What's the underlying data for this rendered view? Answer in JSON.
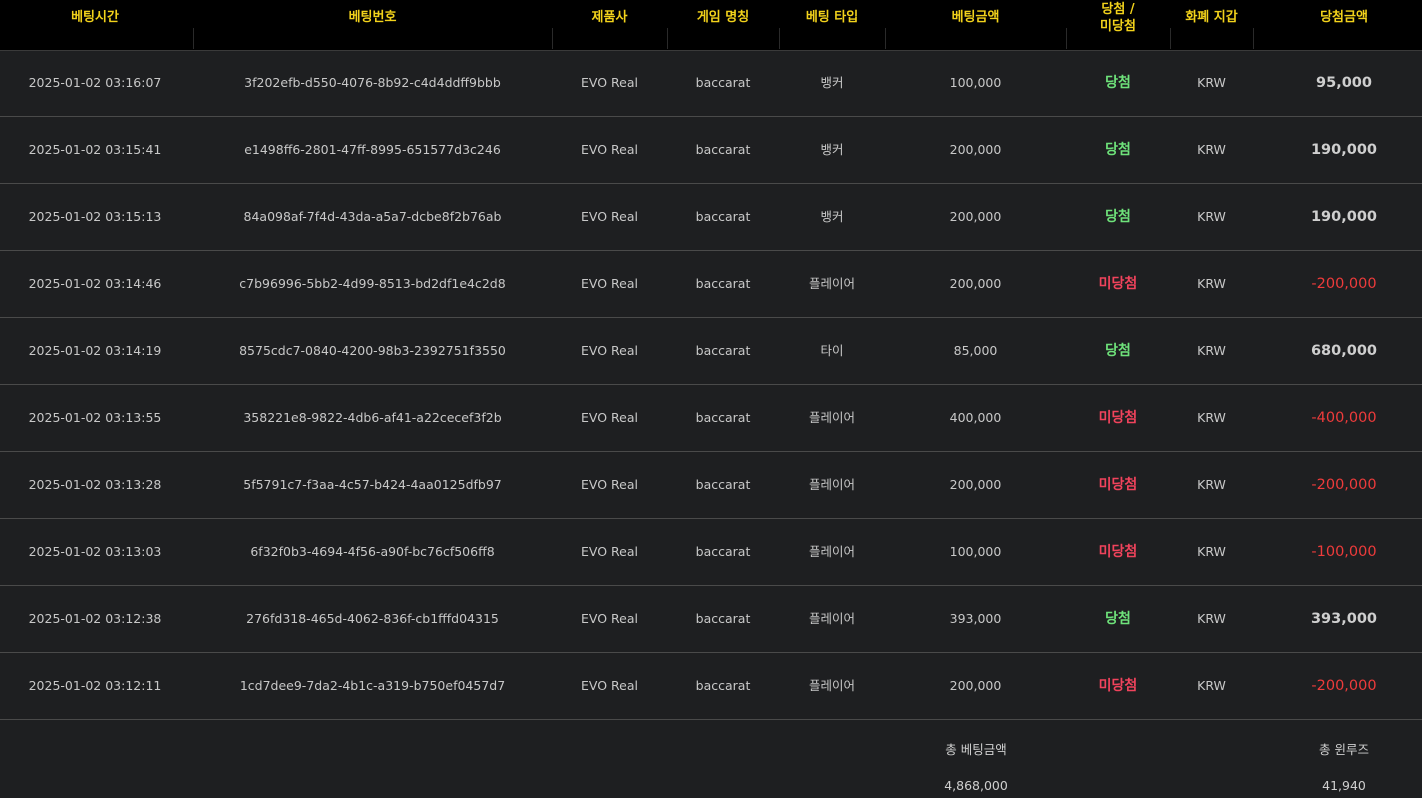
{
  "columns": [
    "베팅시간",
    "베팅번호",
    "제품사",
    "게임 명칭",
    "베팅 타입",
    "베팅금액",
    "당첨 /\n미당첨",
    "화폐 지갑",
    "당첨금액"
  ],
  "column_line1": [
    "베팅시간",
    "베팅번호",
    "제품사",
    "게임 명칭",
    "베팅 타입",
    "베팅금액",
    "당첨 /",
    "화폐 지갑",
    "당첨금액"
  ],
  "column_line2": [
    "",
    "",
    "",
    "",
    "",
    "",
    "미당첨",
    "",
    ""
  ],
  "colors": {
    "header_text": "#f2d21b",
    "win": "#6ee27a",
    "lose": "#f0435c",
    "negative_amount": "#ee3b3b"
  },
  "rows": [
    {
      "time": "2025-01-02 03:16:07",
      "id": "3f202efb-d550-4076-8b92-c4d4ddff9bbb",
      "vendor": "EVO Real",
      "game": "baccarat",
      "type": "뱅커",
      "bet": "100,000",
      "result": "당첨",
      "result_status": "win",
      "currency": "KRW",
      "payout": "95,000"
    },
    {
      "time": "2025-01-02 03:15:41",
      "id": "e1498ff6-2801-47ff-8995-651577d3c246",
      "vendor": "EVO Real",
      "game": "baccarat",
      "type": "뱅커",
      "bet": "200,000",
      "result": "당첨",
      "result_status": "win",
      "currency": "KRW",
      "payout": "190,000"
    },
    {
      "time": "2025-01-02 03:15:13",
      "id": "84a098af-7f4d-43da-a5a7-dcbe8f2b76ab",
      "vendor": "EVO Real",
      "game": "baccarat",
      "type": "뱅커",
      "bet": "200,000",
      "result": "당첨",
      "result_status": "win",
      "currency": "KRW",
      "payout": "190,000"
    },
    {
      "time": "2025-01-02 03:14:46",
      "id": "c7b96996-5bb2-4d99-8513-bd2df1e4c2d8",
      "vendor": "EVO Real",
      "game": "baccarat",
      "type": "플레이어",
      "bet": "200,000",
      "result": "미당첨",
      "result_status": "lose",
      "currency": "KRW",
      "payout": "-200,000"
    },
    {
      "time": "2025-01-02 03:14:19",
      "id": "8575cdc7-0840-4200-98b3-2392751f3550",
      "vendor": "EVO Real",
      "game": "baccarat",
      "type": "타이",
      "bet": "85,000",
      "result": "당첨",
      "result_status": "win",
      "currency": "KRW",
      "payout": "680,000"
    },
    {
      "time": "2025-01-02 03:13:55",
      "id": "358221e8-9822-4db6-af41-a22cecef3f2b",
      "vendor": "EVO Real",
      "game": "baccarat",
      "type": "플레이어",
      "bet": "400,000",
      "result": "미당첨",
      "result_status": "lose",
      "currency": "KRW",
      "payout": "-400,000"
    },
    {
      "time": "2025-01-02 03:13:28",
      "id": "5f5791c7-f3aa-4c57-b424-4aa0125dfb97",
      "vendor": "EVO Real",
      "game": "baccarat",
      "type": "플레이어",
      "bet": "200,000",
      "result": "미당첨",
      "result_status": "lose",
      "currency": "KRW",
      "payout": "-200,000"
    },
    {
      "time": "2025-01-02 03:13:03",
      "id": "6f32f0b3-4694-4f56-a90f-bc76cf506ff8",
      "vendor": "EVO Real",
      "game": "baccarat",
      "type": "플레이어",
      "bet": "100,000",
      "result": "미당첨",
      "result_status": "lose",
      "currency": "KRW",
      "payout": "-100,000"
    },
    {
      "time": "2025-01-02 03:12:38",
      "id": "276fd318-465d-4062-836f-cb1fffd04315",
      "vendor": "EVO Real",
      "game": "baccarat",
      "type": "플레이어",
      "bet": "393,000",
      "result": "당첨",
      "result_status": "win",
      "currency": "KRW",
      "payout": "393,000"
    },
    {
      "time": "2025-01-02 03:12:11",
      "id": "1cd7dee9-7da2-4b1c-a319-b750ef0457d7",
      "vendor": "EVO Real",
      "game": "baccarat",
      "type": "플레이어",
      "bet": "200,000",
      "result": "미당첨",
      "result_status": "lose",
      "currency": "KRW",
      "payout": "-200,000"
    }
  ],
  "summary": {
    "total_bet_label": "총 베팅금액",
    "total_bet_value": "4,868,000",
    "winloss_label": "총 윈루즈",
    "winloss_value": "41,940"
  }
}
